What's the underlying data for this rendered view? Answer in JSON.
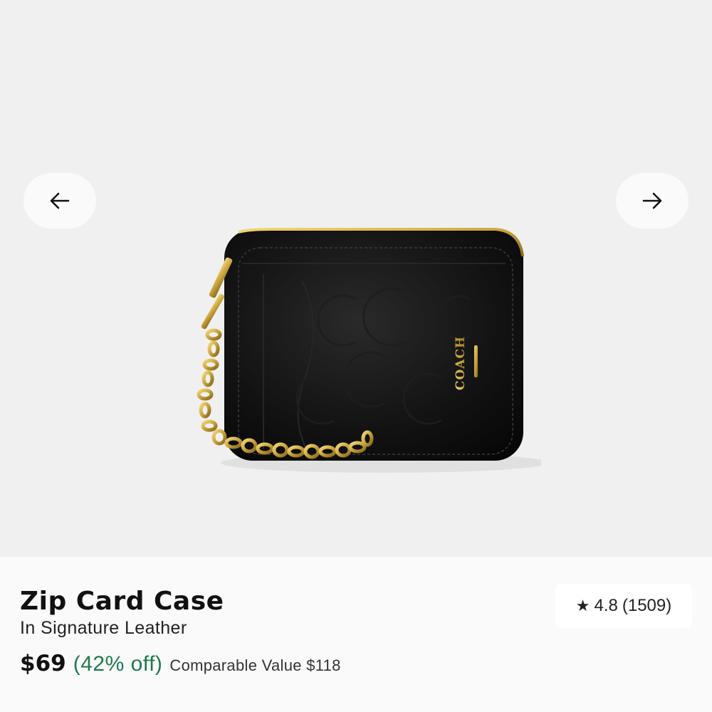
{
  "product": {
    "name": "Zip Card Case",
    "subtitle": "In Signature Leather",
    "price": "$69",
    "discount": "(42% off)",
    "comparable": "Comparable Value $118",
    "rating": "4.8",
    "review_count": "(1509)",
    "logo_text": "COACH"
  },
  "carousel": {
    "prev_icon": "arrow-left-icon",
    "next_icon": "arrow-right-icon"
  },
  "colors": {
    "background": "#f0f0f0",
    "discount": "#1f7a4c",
    "leather": "#0e0e0e",
    "hardware": "#c9a23a"
  }
}
